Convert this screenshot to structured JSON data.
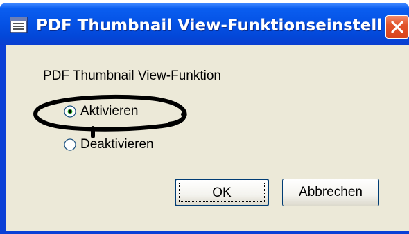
{
  "window": {
    "title": "PDF Thumbnail View-Funktionseinstell...",
    "icon": "document-icon",
    "close_icon": "close-icon"
  },
  "group": {
    "label": "PDF Thumbnail View-Funktion"
  },
  "options": [
    {
      "label": "Aktivieren",
      "selected": true
    },
    {
      "label": "Deaktivieren",
      "selected": false
    }
  ],
  "buttons": {
    "ok_label": "OK",
    "cancel_label": "Abbrechen"
  },
  "colors": {
    "titlebar": "#0553e6",
    "client": "#ece9d8",
    "close_button": "#e2542c"
  }
}
